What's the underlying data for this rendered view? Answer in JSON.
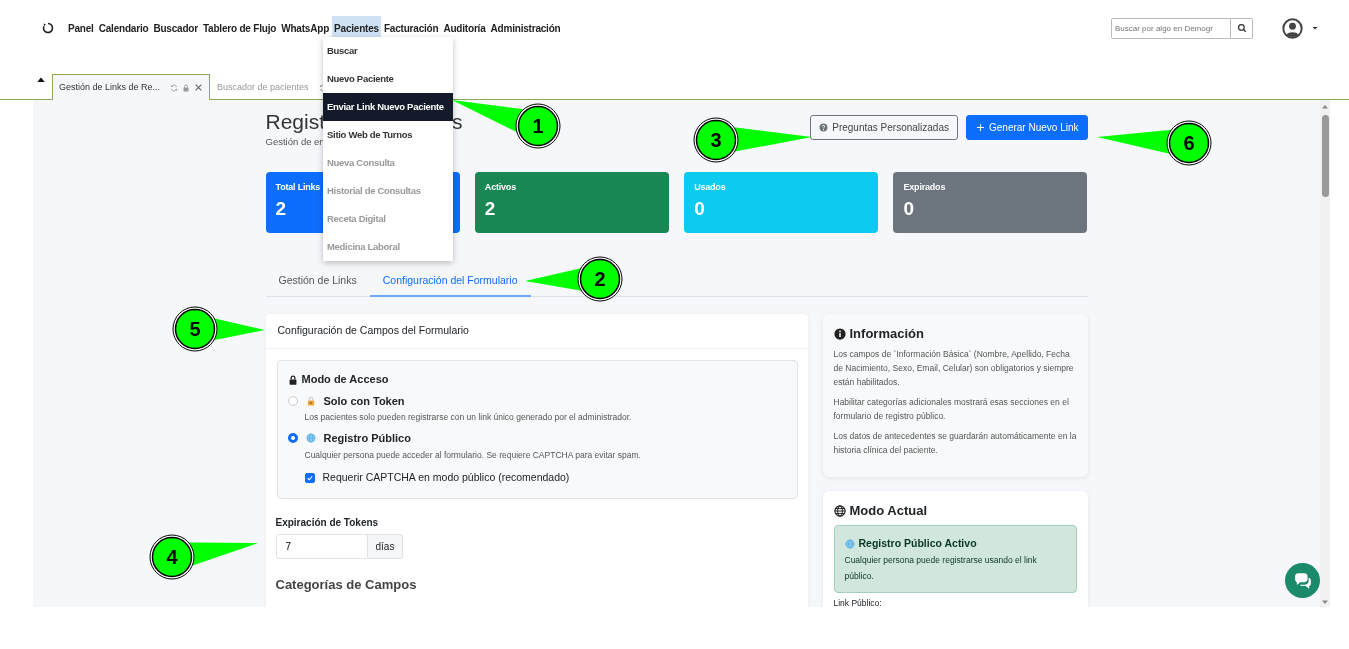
{
  "navbar": {
    "menu": [
      {
        "label": "Panel",
        "selected": false
      },
      {
        "label": "Calendario",
        "selected": false
      },
      {
        "label": "Buscador",
        "selected": false
      },
      {
        "label": "Tablero de Flujo",
        "selected": false
      },
      {
        "label": "WhatsApp",
        "selected": false
      },
      {
        "label": "Pacientes",
        "selected": true
      },
      {
        "label": "Facturación",
        "selected": false
      },
      {
        "label": "Auditoría",
        "selected": false
      },
      {
        "label": "Administración",
        "selected": false
      }
    ],
    "search": {
      "placeholder": "Buscar por algo en Demogr"
    }
  },
  "dropdown": [
    {
      "label": "Buscar",
      "selected": false,
      "disabled": false
    },
    {
      "label": "Nuevo Paciente",
      "selected": false,
      "disabled": false
    },
    {
      "label": "Enviar Link Nuevo Paciente",
      "selected": true,
      "disabled": false
    },
    {
      "label": "Sitio Web de Turnos",
      "selected": false,
      "disabled": false
    },
    {
      "label": "Nueva Consulta",
      "selected": false,
      "disabled": true
    },
    {
      "label": "Historial de Consultas",
      "selected": false,
      "disabled": true
    },
    {
      "label": "Receta Digital",
      "selected": false,
      "disabled": true
    },
    {
      "label": "Medicina Laboral",
      "selected": false,
      "disabled": true
    }
  ],
  "page_tabs": [
    {
      "label": "Gestión de Links de Re...",
      "selected": true,
      "closable": true
    },
    {
      "label": "Buscador de pacientes",
      "selected": false,
      "closable": false
    }
  ],
  "header": {
    "title_start": "Regist",
    "title_end": "s",
    "subtitle": "Gestión de en",
    "buttons": [
      {
        "label": "Preguntas Personalizadas",
        "kind": "outline"
      },
      {
        "label": "Generar Nuevo Link",
        "kind": "primary"
      }
    ]
  },
  "stats": [
    {
      "label": "Total Links",
      "value": "2",
      "color": "#0d6efd"
    },
    {
      "label": "Activos",
      "value": "2",
      "color": "#198754"
    },
    {
      "label": "Usados",
      "value": "0",
      "color": "#0dcaf0"
    },
    {
      "label": "Expirados",
      "value": "0",
      "color": "#6c757d"
    }
  ],
  "section_tabs": [
    {
      "label": "Gestión de Links",
      "selected": false
    },
    {
      "label": "Configuración del Formulario",
      "selected": true
    }
  ],
  "form_card": {
    "title": "Configuración de Campos del Formulario",
    "access_mode": {
      "title": "Modo de Acceso",
      "options": [
        {
          "label": "Solo con Token",
          "description": "Los pacientes solo pueden registrarse con un link único generado por el administrador.",
          "kind": "token",
          "selected": false
        },
        {
          "label": "Registro Público",
          "description": "Cualquier persona puede acceder al formulario. Se requiere CAPTCHA para evitar spam.",
          "kind": "public",
          "selected": true
        }
      ],
      "captcha": {
        "label": "Requerir CAPTCHA en modo público (recomendado)",
        "checked": true
      }
    },
    "expiration": {
      "label": "Expiración de Tokens",
      "value": "7",
      "unit": "días"
    },
    "categories_title": "Categorías de Campos"
  },
  "info_card": {
    "title": "Información",
    "paragraphs": [
      "Los campos de `Información Básica` (Nombre, Apellido, Fecha de Nacimiento, Sexo, Email, Celular) son obligatorios y siempre están habilitados.",
      "Habilitar categorías adicionales mostrará esas secciones en el formulario de registro público.",
      "Los datos de antecedentes se guardarán automáticamente en la historia clínica del paciente."
    ]
  },
  "mode_card": {
    "title": "Modo Actual",
    "alert": {
      "title": "Registro Público Activo",
      "text": "Cualquier persona puede registrarse usando el link público."
    },
    "link_label": "Link Público:"
  },
  "callouts": [
    {
      "label": "1"
    },
    {
      "label": "2"
    },
    {
      "label": "3"
    },
    {
      "label": "4"
    },
    {
      "label": "5"
    },
    {
      "label": "6"
    }
  ]
}
